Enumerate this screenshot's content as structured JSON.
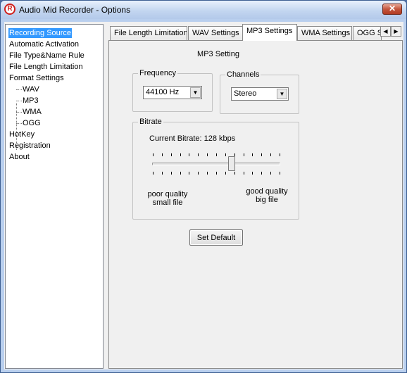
{
  "window": {
    "title": "Audio Mid Recorder - Options",
    "close_glyph": "✕"
  },
  "tree": {
    "items": [
      {
        "label": "Recording Source",
        "selected": true
      },
      {
        "label": "Automatic Activation"
      },
      {
        "label": "File Type&Name Rule"
      },
      {
        "label": "File Length Limitation"
      },
      {
        "label": "Format Settings"
      },
      {
        "label": "WAV"
      },
      {
        "label": "MP3"
      },
      {
        "label": "WMA"
      },
      {
        "label": "OGG"
      },
      {
        "label": "HotKey"
      },
      {
        "label": "Registration"
      },
      {
        "label": "About"
      }
    ]
  },
  "tabs": [
    {
      "label": "File Length Limitation"
    },
    {
      "label": "WAV Settings"
    },
    {
      "label": "MP3 Settings",
      "active": true
    },
    {
      "label": "WMA Settings"
    },
    {
      "label": "OGG Settings"
    }
  ],
  "tab_scroll": {
    "left": "◀",
    "right": "▶"
  },
  "mp3": {
    "title": "MP3 Setting",
    "frequency": {
      "label": "Frequency",
      "value": "44100 Hz"
    },
    "channels": {
      "label": "Channels",
      "value": "Stereo"
    },
    "bitrate": {
      "label": "Bitrate",
      "current": "Current Bitrate: 128 kbps",
      "slider_fraction": 0.62,
      "tick_count": 15,
      "low_line1": "poor quality",
      "low_line2": "small file",
      "high_line1": "good quality",
      "high_line2": "big file"
    },
    "set_default": "Set Default"
  }
}
